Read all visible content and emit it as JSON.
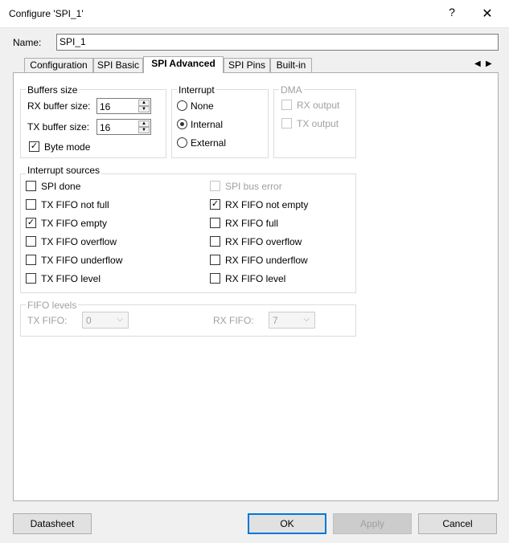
{
  "window": {
    "title": "Configure 'SPI_1'",
    "help": "?",
    "close": "✕"
  },
  "name_field": {
    "label": "Name:",
    "value": "SPI_1"
  },
  "tabs": [
    {
      "label": "Configuration"
    },
    {
      "label": "SPI Basic"
    },
    {
      "label": "SPI Advanced"
    },
    {
      "label": "SPI Pins"
    },
    {
      "label": "Built-in"
    }
  ],
  "tab_nav": {
    "prev": "◀",
    "next": "▶"
  },
  "buffers": {
    "title": "Buffers size",
    "rx_label": "RX buffer size:",
    "rx_value": "16",
    "tx_label": "TX buffer size:",
    "tx_value": "16",
    "byte_mode_label": "Byte mode",
    "byte_mode_checked": true
  },
  "interrupt": {
    "title": "Interrupt",
    "options": [
      {
        "label": "None",
        "selected": false
      },
      {
        "label": "Internal",
        "selected": true
      },
      {
        "label": "External",
        "selected": false
      }
    ]
  },
  "dma": {
    "title": "DMA",
    "rx_label": "RX output",
    "tx_label": "TX output"
  },
  "sources": {
    "title": "Interrupt sources",
    "left": [
      {
        "label": "SPI done",
        "checked": false
      },
      {
        "label": "TX FIFO not full",
        "checked": false
      },
      {
        "label": "TX FIFO empty",
        "checked": true
      },
      {
        "label": "TX FIFO overflow",
        "checked": false
      },
      {
        "label": "TX FIFO underflow",
        "checked": false
      },
      {
        "label": "TX FIFO level",
        "checked": false
      }
    ],
    "right": [
      {
        "label": "SPI bus error",
        "checked": false,
        "disabled": true
      },
      {
        "label": "RX FIFO not empty",
        "checked": true
      },
      {
        "label": "RX FIFO full",
        "checked": false
      },
      {
        "label": "RX FIFO overflow",
        "checked": false
      },
      {
        "label": "RX FIFO underflow",
        "checked": false
      },
      {
        "label": "RX FIFO level",
        "checked": false
      }
    ]
  },
  "fifo": {
    "title": "FIFO levels",
    "tx_label": "TX FIFO:",
    "tx_value": "0",
    "rx_label": "RX FIFO:",
    "rx_value": "7",
    "chevron": "⌵"
  },
  "buttons": {
    "datasheet": "Datasheet",
    "ok": "OK",
    "apply": "Apply",
    "cancel": "Cancel"
  },
  "check_mark": "✓"
}
